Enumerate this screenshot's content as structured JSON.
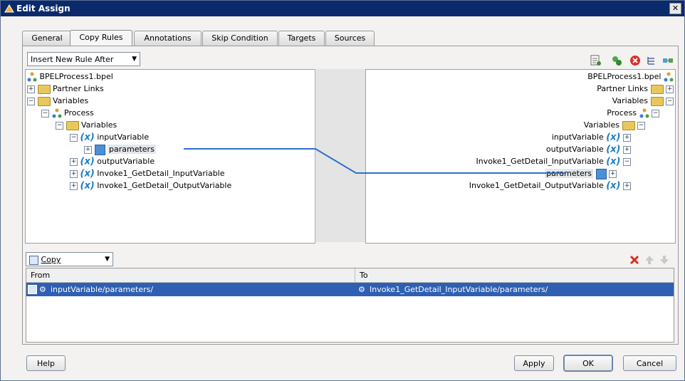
{
  "window": {
    "title": "Edit Assign",
    "close_label": "✕"
  },
  "tabs": [
    "General",
    "Copy Rules",
    "Annotations",
    "Skip Condition",
    "Targets",
    "Sources"
  ],
  "active_tab": "Copy Rules",
  "rule_dropdown": {
    "value": "Insert New Rule After"
  },
  "source_tree": [
    {
      "label": "BPELProcess1.bpel",
      "icon": "bpel-icon"
    },
    {
      "label": "Partner Links",
      "icon": "folder-icon"
    },
    {
      "label": "Variables",
      "icon": "folder-icon"
    },
    {
      "label": "Process",
      "icon": "bpel-icon"
    },
    {
      "label": "Variables",
      "icon": "folder-icon"
    },
    {
      "label": "inputVariable",
      "icon": "variable-icon"
    },
    {
      "label": "parameters",
      "icon": "parameter-icon"
    },
    {
      "label": "outputVariable",
      "icon": "variable-icon"
    },
    {
      "label": "Invoke1_GetDetail_InputVariable",
      "icon": "variable-icon"
    },
    {
      "label": "Invoke1_GetDetail_OutputVariable",
      "icon": "variable-icon"
    }
  ],
  "target_tree": [
    {
      "label": "BPELProcess1.bpel",
      "icon": "bpel-icon"
    },
    {
      "label": "Partner Links",
      "icon": "folder-icon"
    },
    {
      "label": "Variables",
      "icon": "folder-icon"
    },
    {
      "label": "Process",
      "icon": "bpel-icon"
    },
    {
      "label": "Variables",
      "icon": "folder-icon"
    },
    {
      "label": "inputVariable",
      "icon": "variable-icon"
    },
    {
      "label": "outputVariable",
      "icon": "variable-icon"
    },
    {
      "label": "Invoke1_GetDetail_InputVariable",
      "icon": "variable-icon"
    },
    {
      "label": "parameters",
      "icon": "parameter-icon"
    },
    {
      "label": "Invoke1_GetDetail_OutputVariable",
      "icon": "variable-icon"
    }
  ],
  "var_prefix": "(x)",
  "operation_dropdown": {
    "value": "Copy"
  },
  "rules_table": {
    "columns": [
      "From",
      "To"
    ],
    "rows": [
      {
        "from": "inputVariable/parameters/",
        "to": "Invoke1_GetDetail_InputVariable/parameters/"
      }
    ]
  },
  "buttons": {
    "help": "Help",
    "apply": "Apply",
    "ok": "OK",
    "cancel": "Cancel"
  },
  "colors": {
    "titlebar": "#0b2a6b",
    "selection": "#2f5fb2",
    "mapping_line": "#2e6fcf"
  }
}
